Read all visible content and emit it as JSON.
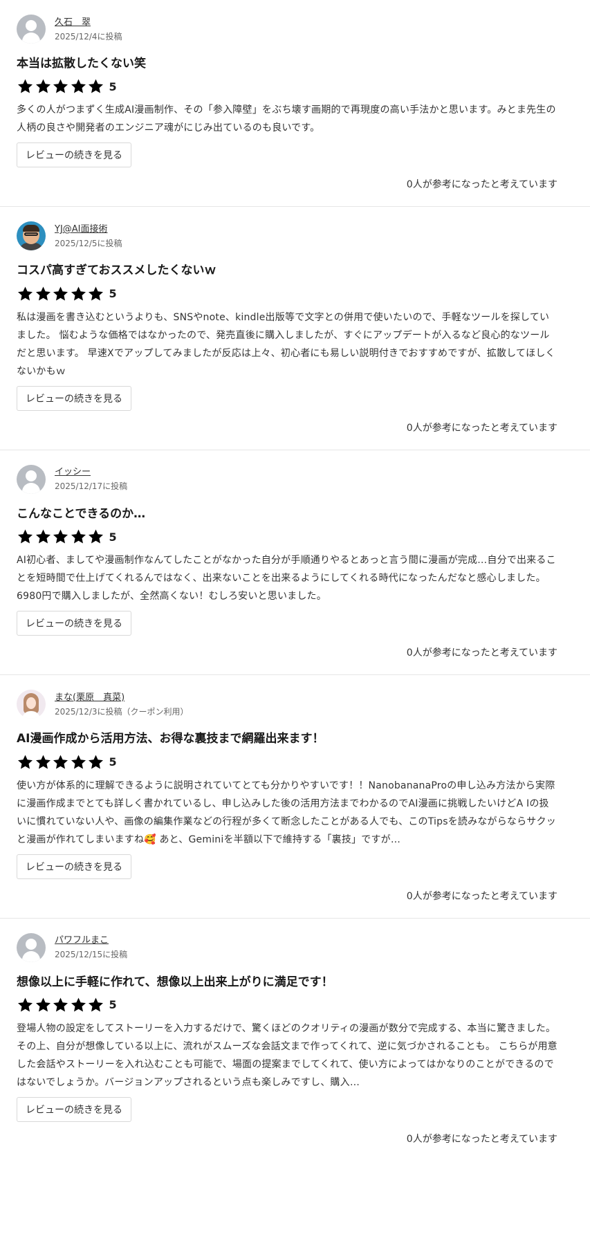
{
  "reviews": [
    {
      "author": "久石　翠",
      "date": "2025/12/4に投稿",
      "title": "本当は拡散したくない笑",
      "rating": "5",
      "text": "多くの人がつまずく生成AI漫画制作、その「参入障壁」をぶち壊す画期的で再現度の高い手法かと思います。みとま先生の人柄の良さや開発者のエンジニア魂がにじみ出ているのも良いです。",
      "more_label": "レビューの続きを見る",
      "helpful": "0人が参考になったと考えています"
    },
    {
      "author": "YJ@AI面接術",
      "date": "2025/12/5に投稿",
      "title": "コスパ高すぎておススメしたくないｗ",
      "rating": "5",
      "text": "私は漫画を書き込むというよりも、SNSやnote、kindle出版等で文字との併用で使いたいので、手軽なツールを探していました。 悩むような価格ではなかったので、発売直後に購入しましたが、すぐにアップデートが入るなど良心的なツールだと思います。 早速Xでアップしてみましたが反応は上々、初心者にも易しい説明付きでおすすめですが、拡散してほしくないかもｗ",
      "more_label": "レビューの続きを見る",
      "helpful": "0人が参考になったと考えています"
    },
    {
      "author": "イッシー",
      "date": "2025/12/17に投稿",
      "title": "こんなことできるのか…",
      "rating": "5",
      "text": "AI初心者、ましてや漫画制作なんてしたことがなかった自分が手順通りやるとあっと言う間に漫画が完成…自分で出来ることを短時間で仕上げてくれるんではなく、出来ないことを出来るようにしてくれる時代になったんだなと感心しました。6980円で購入しましたが、全然高くない！むしろ安いと思いました。",
      "more_label": "レビューの続きを見る",
      "helpful": "0人が参考になったと考えています"
    },
    {
      "author": "まな(栗原　真菜)",
      "date": "2025/12/3に投稿（クーポン利用）",
      "title": "AI漫画作成から活用方法、お得な裏技まで網羅出来ます！",
      "rating": "5",
      "text": "使い方が体系的に理解できるように説明されていてとても分かりやすいです！！NanobananaProの申し込み方法から実際に漫画作成までとても詳しく書かれているし、申し込みした後の活用方法までわかるのでAI漫画に挑戦したいけどA Iの扱いに慣れていない人や、画像の編集作業などの行程が多くて断念したことがある人でも、このTipsを読みながらならサクッと漫画が作れてしまいますね🥰 あと、Geminiを半額以下で維持する「裏技」ですが…",
      "more_label": "レビューの続きを見る",
      "helpful": "0人が参考になったと考えています"
    },
    {
      "author": "パワフルまこ",
      "date": "2025/12/15に投稿",
      "title": "想像以上に手軽に作れて、想像以上出来上がりに満足です！",
      "rating": "5",
      "text": "登場人物の設定をしてストーリーを入力するだけで、驚くほどのクオリティの漫画が数分で完成する、本当に驚きました。その上、自分が想像している以上に、流れがスムーズな会話文まで作ってくれて、逆に気づかされることも。 こちらが用意した会話やストーリーを入れ込むことも可能で、場面の提案までしてくれて、使い方によってはかなりのことができるのではないでしょうか。バージョンアップされるという点も楽しみですし、購入…",
      "more_label": "レビューの続きを見る",
      "helpful": "0人が参考になったと考えています"
    }
  ]
}
